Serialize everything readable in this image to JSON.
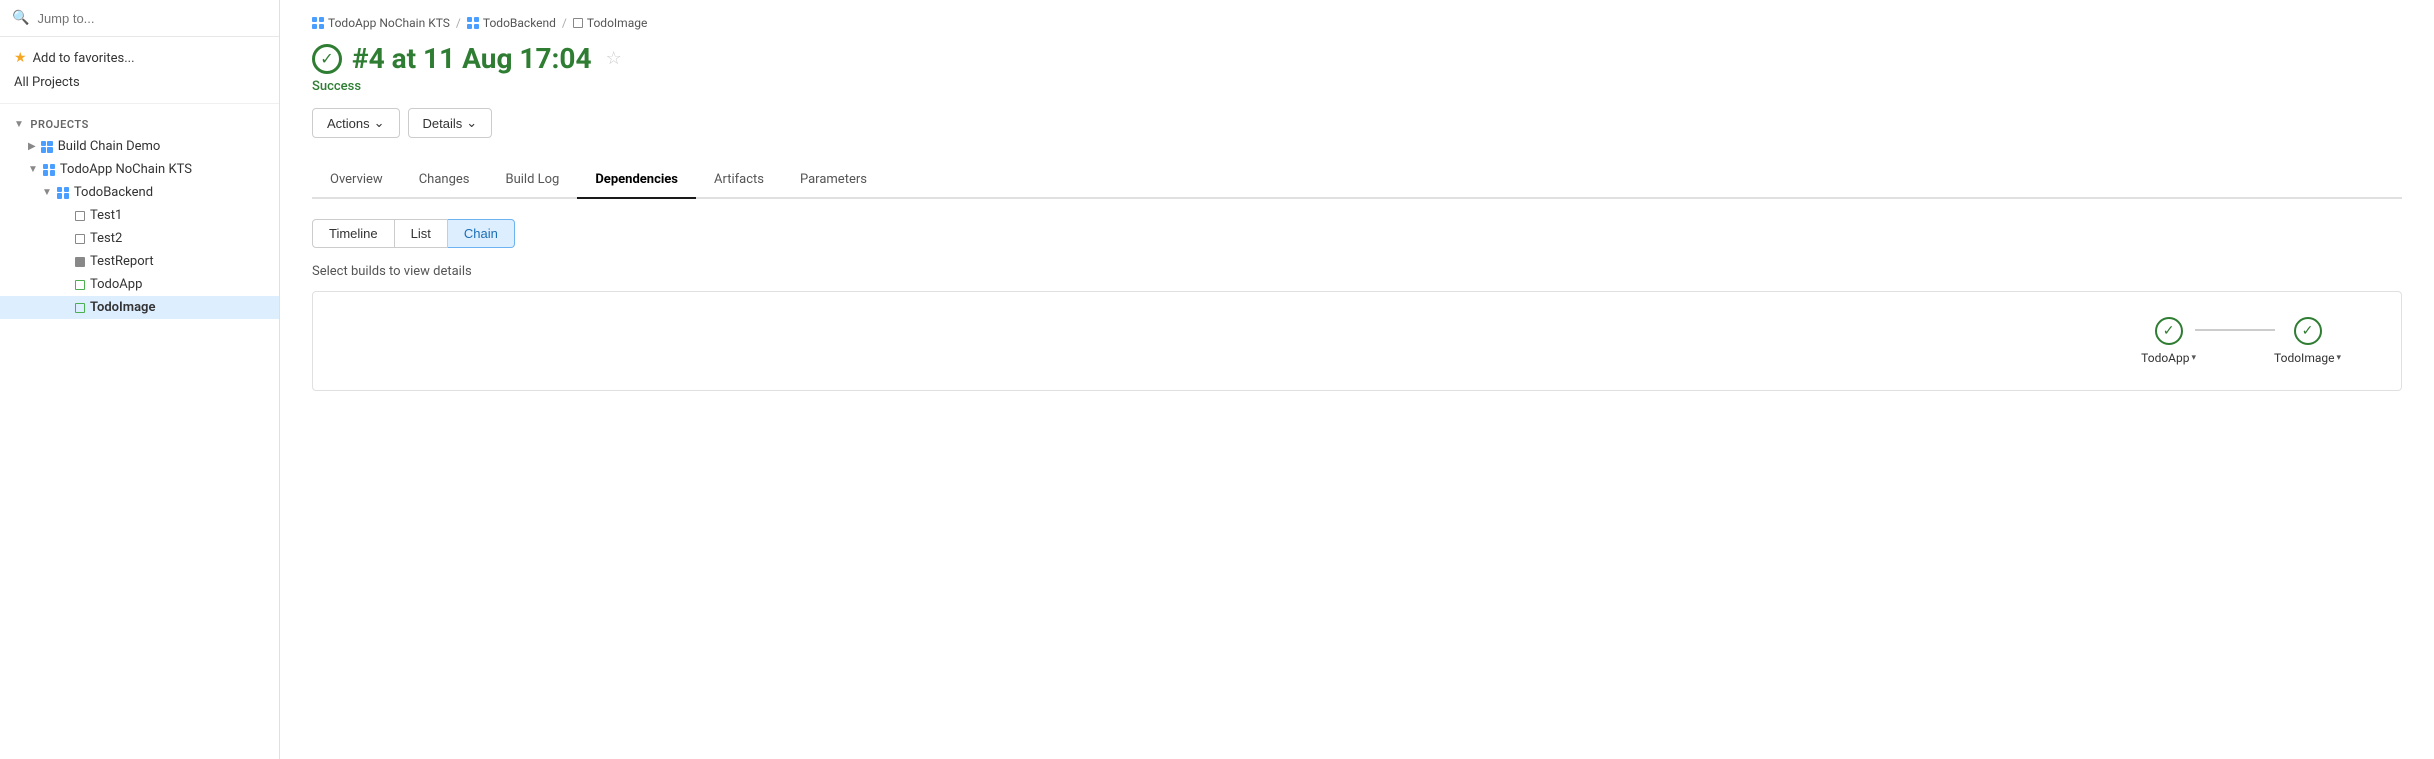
{
  "sidebar": {
    "search_placeholder": "Jump to...",
    "add_favorites_label": "Add to favorites...",
    "all_projects_label": "All Projects",
    "projects_header": "PROJECTS",
    "tree": [
      {
        "id": "build-chain-demo",
        "label": "Build Chain Demo",
        "level": 1,
        "type": "grid",
        "expanded": false
      },
      {
        "id": "todoapp-nochain-kts",
        "label": "TodoApp NoChain KTS",
        "level": 1,
        "type": "grid",
        "expanded": true
      },
      {
        "id": "todobackend",
        "label": "TodoBackend",
        "level": 2,
        "type": "grid",
        "expanded": true
      },
      {
        "id": "test1",
        "label": "Test1",
        "level": 3,
        "type": "square"
      },
      {
        "id": "test2",
        "label": "Test2",
        "level": 3,
        "type": "square"
      },
      {
        "id": "testreport",
        "label": "TestReport",
        "level": 3,
        "type": "square-filled"
      },
      {
        "id": "todoapp",
        "label": "TodoApp",
        "level": 3,
        "type": "square-green"
      },
      {
        "id": "todoimage",
        "label": "TodoImage",
        "level": 3,
        "type": "square-green",
        "active": true
      }
    ]
  },
  "breadcrumb": {
    "items": [
      {
        "icon": "grid",
        "label": "TodoApp NoChain KTS"
      },
      {
        "icon": "grid",
        "label": "TodoBackend"
      },
      {
        "icon": "square",
        "label": "TodoImage"
      }
    ]
  },
  "build": {
    "title": "#4 at 11 Aug 17:04",
    "status": "Success",
    "star_label": "☆"
  },
  "action_buttons": [
    {
      "id": "actions-btn",
      "label": "Actions",
      "has_chevron": true
    },
    {
      "id": "details-btn",
      "label": "Details",
      "has_chevron": true
    }
  ],
  "tabs": [
    {
      "id": "overview",
      "label": "Overview",
      "active": false
    },
    {
      "id": "changes",
      "label": "Changes",
      "active": false
    },
    {
      "id": "build-log",
      "label": "Build Log",
      "active": false
    },
    {
      "id": "dependencies",
      "label": "Dependencies",
      "active": true
    },
    {
      "id": "artifacts",
      "label": "Artifacts",
      "active": false
    },
    {
      "id": "parameters",
      "label": "Parameters",
      "active": false
    }
  ],
  "sub_tabs": [
    {
      "id": "timeline",
      "label": "Timeline",
      "active": false
    },
    {
      "id": "list",
      "label": "List",
      "active": false
    },
    {
      "id": "chain",
      "label": "Chain",
      "active": true
    }
  ],
  "chain": {
    "select_builds_text": "Select builds to view details",
    "nodes": [
      {
        "id": "todo-app-node",
        "label": "TodoApp",
        "status": "success"
      },
      {
        "id": "todo-image-node",
        "label": "TodoImage",
        "status": "success"
      }
    ]
  }
}
